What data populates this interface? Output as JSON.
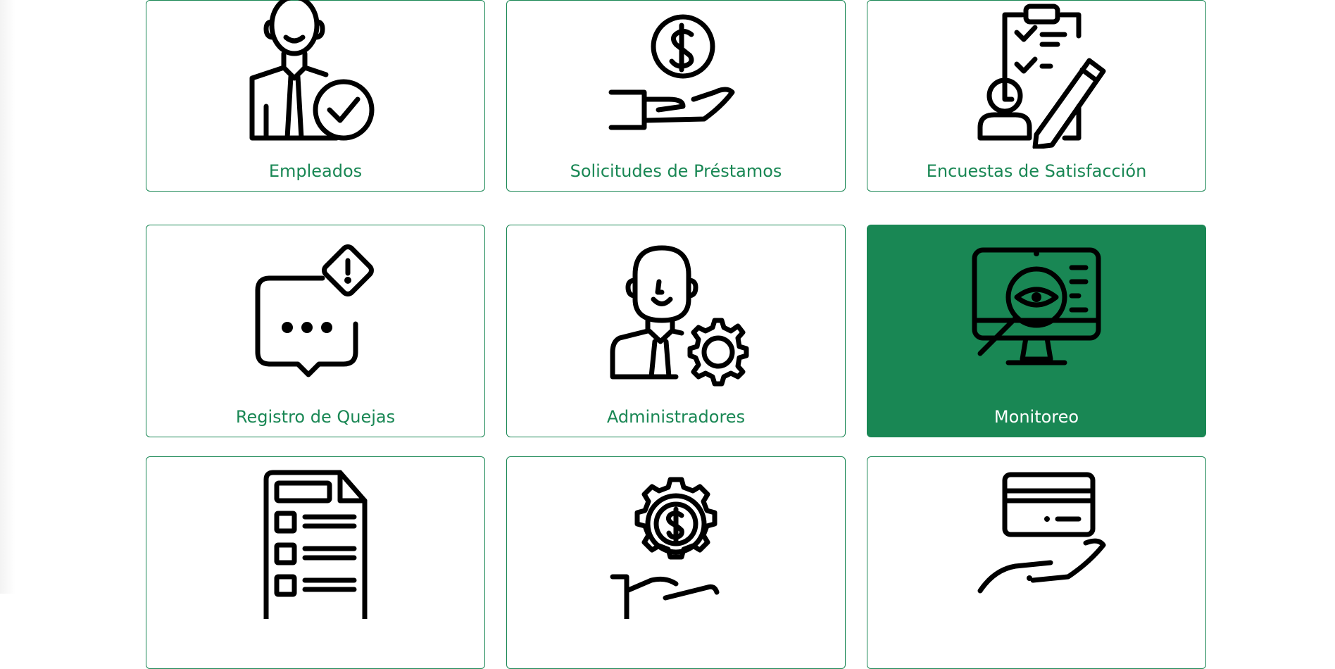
{
  "cards": [
    {
      "label": "Empleados",
      "icon": "employee-check-icon"
    },
    {
      "label": "Solicitudes de Préstamos",
      "icon": "hand-money-icon"
    },
    {
      "label": "Encuestas de Satisfacción",
      "icon": "survey-clipboard-icon"
    },
    {
      "label": "Registro de Quejas",
      "icon": "complaint-chat-icon"
    },
    {
      "label": "Administradores",
      "icon": "admin-gear-icon"
    },
    {
      "label": "Monitoreo",
      "icon": "monitor-eye-icon"
    },
    {
      "label": "",
      "icon": "document-list-icon"
    },
    {
      "label": "",
      "icon": "gear-money-hand-icon"
    },
    {
      "label": "",
      "icon": "hand-card-icon"
    }
  ],
  "colors": {
    "accent": "#198754",
    "active_text": "#ffffff"
  },
  "active_card": "Monitoreo"
}
